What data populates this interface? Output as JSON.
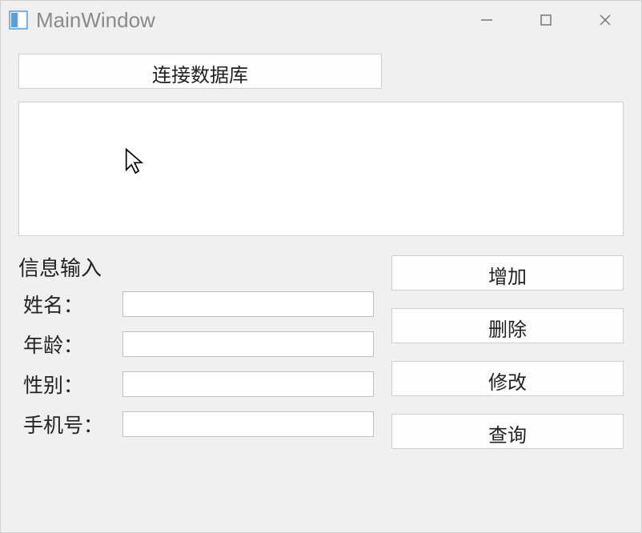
{
  "window": {
    "title": "MainWindow"
  },
  "buttons": {
    "connect": "连接数据库",
    "add": "增加",
    "delete": "删除",
    "modify": "修改",
    "query": "查询"
  },
  "form": {
    "section_title": "信息输入",
    "fields": {
      "name_label": "姓名：",
      "name_value": "",
      "age_label": "年龄：",
      "age_value": "",
      "gender_label": "性别：",
      "gender_value": "",
      "phone_label": "手机号：",
      "phone_value": ""
    }
  },
  "display": {
    "content": ""
  }
}
